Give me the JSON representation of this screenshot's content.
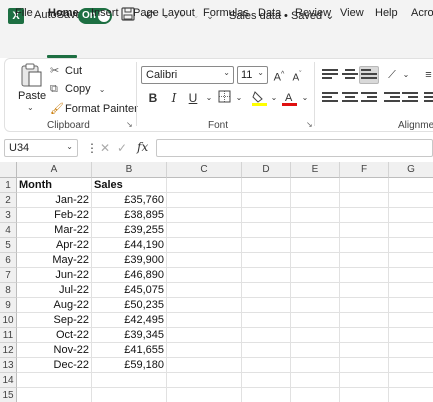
{
  "titlebar": {
    "logo_letter": "X",
    "autosave_label": "AutoSave",
    "autosave_state": "On",
    "doc_title": "Sales data • Saved ⌄"
  },
  "menu": {
    "tabs": [
      "File",
      "Home",
      "Insert",
      "Page Layout",
      "Formulas",
      "Data",
      "Review",
      "View",
      "Help",
      "Acro"
    ],
    "active_tab": "Home"
  },
  "ribbon": {
    "paste_label": "Paste",
    "cut_label": "Cut",
    "copy_label": "Copy",
    "format_painter_label": "Format Painter",
    "clipboard_group": "Clipboard",
    "font_name": "Calibri",
    "font_size": "11",
    "font_group": "Font",
    "alignment_group": "Alignmer",
    "bold": "B",
    "italic": "I",
    "underline": "U",
    "grow_font": "A",
    "shrink_font": "A",
    "accent_color": "#1d6f42",
    "highlight_color": "#ffff00",
    "font_color": "#e01010"
  },
  "formula_bar": {
    "name_box": "U34",
    "fx": "fx",
    "formula": ""
  },
  "sheet": {
    "columns": [
      "A",
      "B",
      "C",
      "D",
      "E",
      "F",
      "G"
    ],
    "rows": [
      "1",
      "2",
      "3",
      "4",
      "5",
      "6",
      "7",
      "8",
      "9",
      "10",
      "11",
      "12",
      "13",
      "14",
      "15"
    ],
    "header": [
      "Month",
      "Sales"
    ],
    "data": [
      [
        "Jan-22",
        "£35,760"
      ],
      [
        "Feb-22",
        "£38,895"
      ],
      [
        "Mar-22",
        "£39,255"
      ],
      [
        "Apr-22",
        "£44,190"
      ],
      [
        "May-22",
        "£39,900"
      ],
      [
        "Jun-22",
        "£46,890"
      ],
      [
        "Jul-22",
        "£45,075"
      ],
      [
        "Aug-22",
        "£50,235"
      ],
      [
        "Sep-22",
        "£42,495"
      ],
      [
        "Oct-22",
        "£39,345"
      ],
      [
        "Nov-22",
        "£41,655"
      ],
      [
        "Dec-22",
        "£59,180"
      ]
    ]
  }
}
